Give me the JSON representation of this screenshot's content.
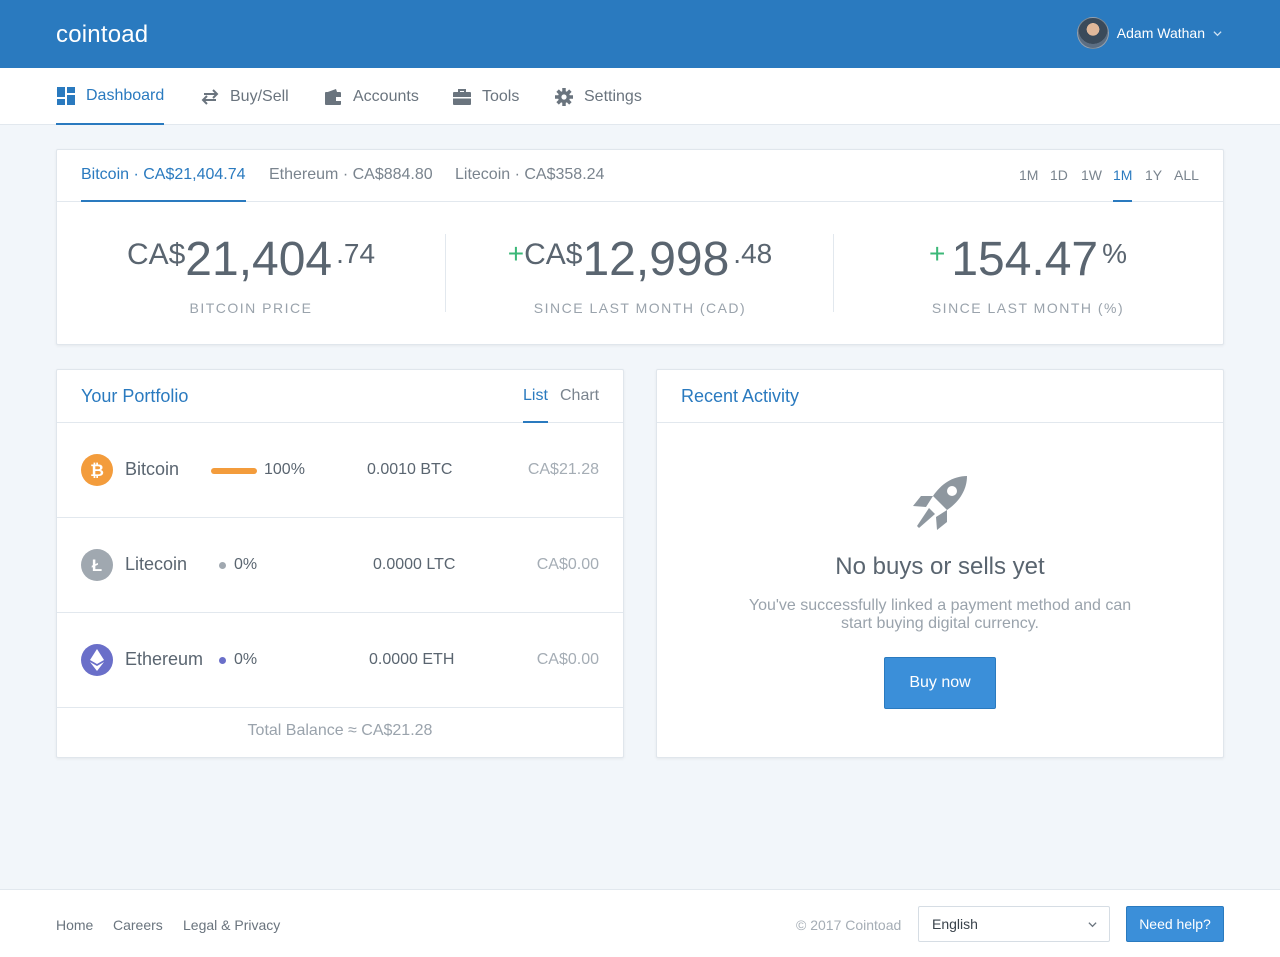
{
  "app": {
    "brand": "cointoad"
  },
  "user": {
    "name": "Adam Wathan"
  },
  "nav": {
    "items": [
      {
        "label": "Dashboard",
        "icon": "dashboard-icon"
      },
      {
        "label": "Buy/Sell",
        "icon": "swap-arrows-icon"
      },
      {
        "label": "Accounts",
        "icon": "wallet-icon"
      },
      {
        "label": "Tools",
        "icon": "briefcase-icon"
      },
      {
        "label": "Settings",
        "icon": "gear-icon"
      }
    ],
    "active": "Dashboard"
  },
  "ticker": {
    "tabs": [
      {
        "label": "Bitcoin · CA$21,404.74"
      },
      {
        "label": "Ethereum · CA$884.80"
      },
      {
        "label": "Litecoin · CA$358.24"
      }
    ],
    "ranges": [
      "1M",
      "1D",
      "1W",
      "1M",
      "1Y",
      "ALL"
    ],
    "active_range": "1M",
    "stats": [
      {
        "currency": "CA$",
        "whole": "21,404",
        "fraction": ".74",
        "label": "Bitcoin price"
      },
      {
        "plus": "+",
        "currency": "CA$",
        "whole": "12,998",
        "fraction": ".48",
        "label": "Since last month (CAD)"
      },
      {
        "plus": "+",
        "whole": "154.47",
        "suffix": "%",
        "label": "Since last month (%)"
      }
    ]
  },
  "portfolio": {
    "title": "Your Portfolio",
    "tabs": [
      "List",
      "Chart"
    ],
    "active_tab": "List",
    "rows": [
      {
        "name": "Bitcoin",
        "percent": "100%",
        "share": 1.0,
        "amount": "0.0010 BTC",
        "fiat": "CA$21.28",
        "color": "#f39c3c"
      },
      {
        "name": "Litecoin",
        "percent": "0%",
        "share": 0.0,
        "amount": "0.0000 LTC",
        "fiat": "CA$0.00",
        "color": "#a0a8b0"
      },
      {
        "name": "Ethereum",
        "percent": "0%",
        "share": 0.0,
        "amount": "0.0000 ETH",
        "fiat": "CA$0.00",
        "color": "#6a6fc9"
      }
    ],
    "total": "Total Balance ≈ CA$21.28"
  },
  "activity": {
    "title": "Recent Activity",
    "empty_icon": "rocket-icon",
    "empty_title": "No buys or sells yet",
    "empty_text": "You've successfully linked a payment method and can start buying digital currency.",
    "cta": "Buy now"
  },
  "footer": {
    "links": [
      "Home",
      "Careers",
      "Legal & Privacy"
    ],
    "copyright": "© 2017 Cointoad",
    "language": "English",
    "help": "Need help?"
  },
  "colors": {
    "brand": "#2a7abf",
    "positive": "#3cb878",
    "bitcoin": "#f39c3c",
    "litecoin": "#a0a8b0",
    "ethereum": "#6a6fc9"
  }
}
